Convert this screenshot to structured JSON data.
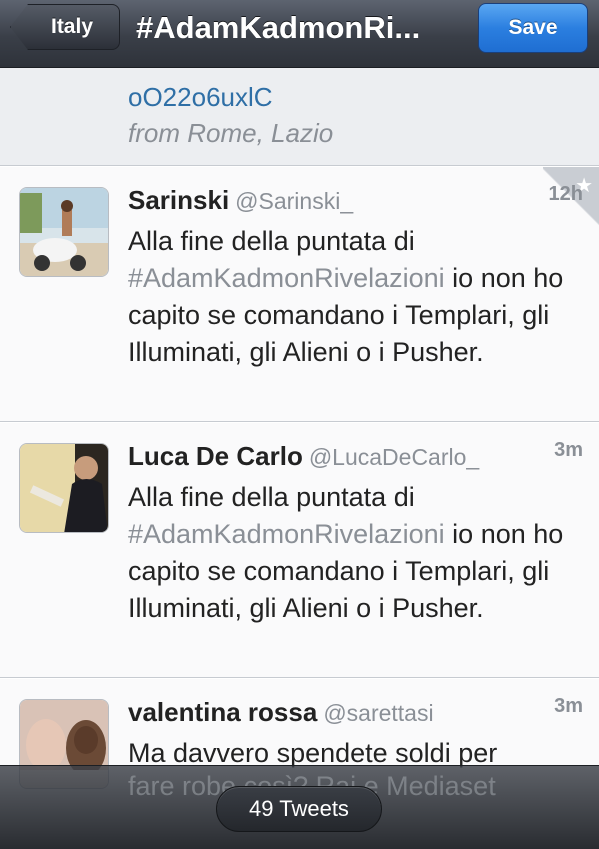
{
  "navbar": {
    "back_label": "Italy",
    "title": "#AdamKadmonRi...",
    "save_label": "Save"
  },
  "partial_tweet": {
    "url_tail": "oO22o6uxlC",
    "location": "from Rome, Lazio"
  },
  "tweets": [
    {
      "name": "Sarinski",
      "handle": "@Sarinski_",
      "time": "12h",
      "text_before": "Alla fine della puntata di ",
      "hashtag": "#AdamKadmonRivelazioni",
      "text_after": " io non ho capito se comandano i Templari, gli Illuminati, gli Alieni o i Pusher.",
      "favorited": true
    },
    {
      "name": "Luca De Carlo",
      "handle": "@LucaDeCarlo_",
      "time": "3m",
      "text_before": "Alla fine della puntata di ",
      "hashtag": "#AdamKadmonRivelazioni",
      "text_after": " io non ho capito se comandano i Templari, gli Illuminati, gli Alieni o i Pusher."
    },
    {
      "name": "valentina rossa",
      "handle": "@sarettasi",
      "time": "3m",
      "text_before": "Ma davvero spendete soldi per",
      "hashtag": "",
      "text_after": ""
    }
  ],
  "bottom": {
    "faded_line": "fare robe così? Rai e Mediaset",
    "tweet_count": "49 Tweets"
  },
  "colors": {
    "accent_blue": "#2b7fe0",
    "link": "#2f6fa6",
    "muted": "#8a8f96"
  }
}
